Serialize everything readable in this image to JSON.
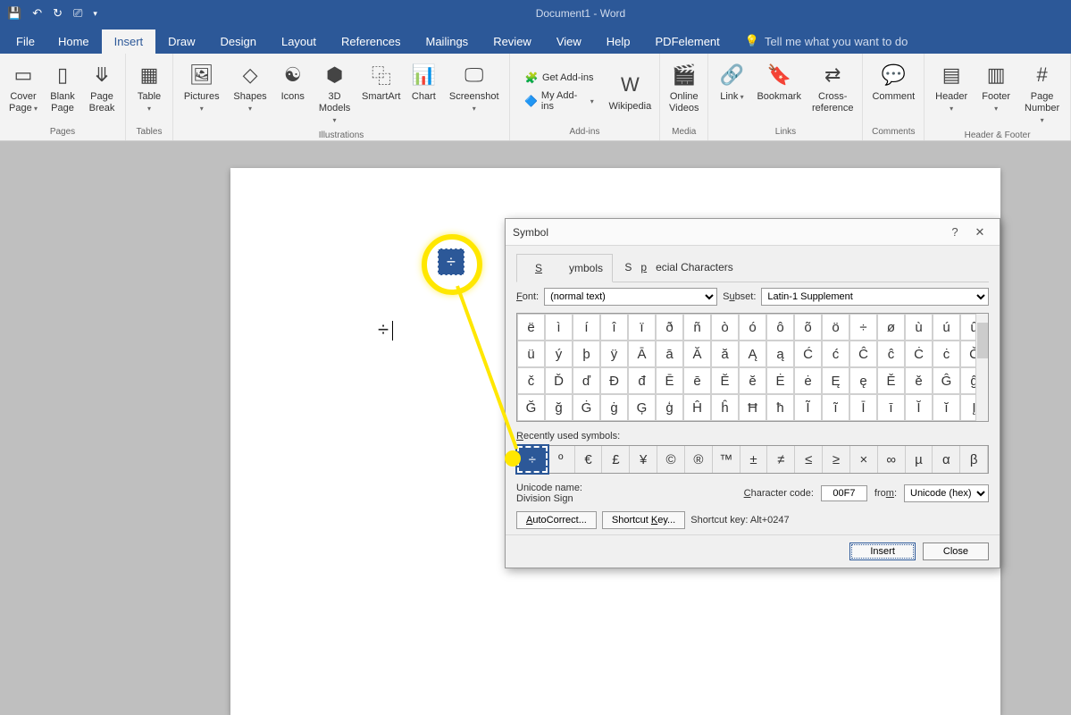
{
  "titlebar": {
    "title": "Document1  -  Word"
  },
  "menubar": {
    "tabs": [
      "File",
      "Home",
      "Insert",
      "Draw",
      "Design",
      "Layout",
      "References",
      "Mailings",
      "Review",
      "View",
      "Help",
      "PDFelement"
    ],
    "active": "Insert",
    "tellme": "Tell me what you want to do"
  },
  "ribbon": {
    "groups": {
      "pages": {
        "label": "Pages",
        "items": [
          "Cover\nPage",
          "Blank\nPage",
          "Page\nBreak"
        ]
      },
      "tables": {
        "label": "Tables",
        "items": [
          "Table"
        ]
      },
      "illustrations": {
        "label": "Illustrations",
        "items": [
          "Pictures",
          "Shapes",
          "Icons",
          "3D\nModels",
          "SmartArt",
          "Chart",
          "Screenshot"
        ]
      },
      "addins": {
        "label": "Add-ins",
        "get": "Get Add-ins",
        "my": "My Add-ins",
        "wiki": "Wikipedia"
      },
      "media": {
        "label": "Media",
        "items": [
          "Online\nVideos"
        ]
      },
      "links": {
        "label": "Links",
        "items": [
          "Link",
          "Bookmark",
          "Cross-\nreference"
        ]
      },
      "comments": {
        "label": "Comments",
        "items": [
          "Comment"
        ]
      },
      "headerfooter": {
        "label": "Header & Footer",
        "items": [
          "Header",
          "Footer",
          "Page\nNumber"
        ]
      }
    }
  },
  "document": {
    "inserted_symbol": "÷"
  },
  "callout": {
    "symbol": "÷"
  },
  "dialog": {
    "title": "Symbol",
    "tabs": {
      "symbols": "Symbols",
      "special": "Special Characters"
    },
    "font_label": "Font:",
    "font_value": "(normal text)",
    "subset_label": "Subset:",
    "subset_value": "Latin-1 Supplement",
    "grid": {
      "r0": [
        "ë",
        "ì",
        "í",
        "î",
        "ï",
        "ð",
        "ñ",
        "ò",
        "ó",
        "ô",
        "õ",
        "ö",
        "÷",
        "ø",
        "ù",
        "ú",
        "û"
      ],
      "r1": [
        "ü",
        "ý",
        "þ",
        "ÿ",
        "Ā",
        "ā",
        "Ă",
        "ă",
        "Ą",
        "ą",
        "Ć",
        "ć",
        "Ĉ",
        "ĉ",
        "Ċ",
        "ċ",
        "Č"
      ],
      "r2": [
        "č",
        "Ď",
        "ď",
        "Đ",
        "đ",
        "Ē",
        "ē",
        "Ĕ",
        "ĕ",
        "Ė",
        "ė",
        "Ę",
        "ę",
        "Ě",
        "ě",
        "Ĝ",
        "ĝ"
      ],
      "r3": [
        "Ğ",
        "ğ",
        "Ġ",
        "ġ",
        "Ģ",
        "ģ",
        "Ĥ",
        "ĥ",
        "Ħ",
        "ħ",
        "Ĩ",
        "ĩ",
        "Ī",
        "ī",
        "Ĭ",
        "ĭ",
        "Į"
      ]
    },
    "recent_label": "Recently used symbols:",
    "recent": [
      "÷",
      "º",
      "€",
      "£",
      "¥",
      "©",
      "®",
      "™",
      "±",
      "≠",
      "≤",
      "≥",
      "×",
      "∞",
      "µ",
      "α",
      "β"
    ],
    "unicode_name_label": "Unicode name:",
    "unicode_name": "Division Sign",
    "charcode_label": "Character code:",
    "charcode": "00F7",
    "from_label": "from:",
    "from_value": "Unicode (hex)",
    "autocorrect": "AutoCorrect...",
    "shortcutkey_btn": "Shortcut Key...",
    "shortcut_text": "Shortcut key: Alt+0247",
    "insert": "Insert",
    "close": "Close"
  }
}
